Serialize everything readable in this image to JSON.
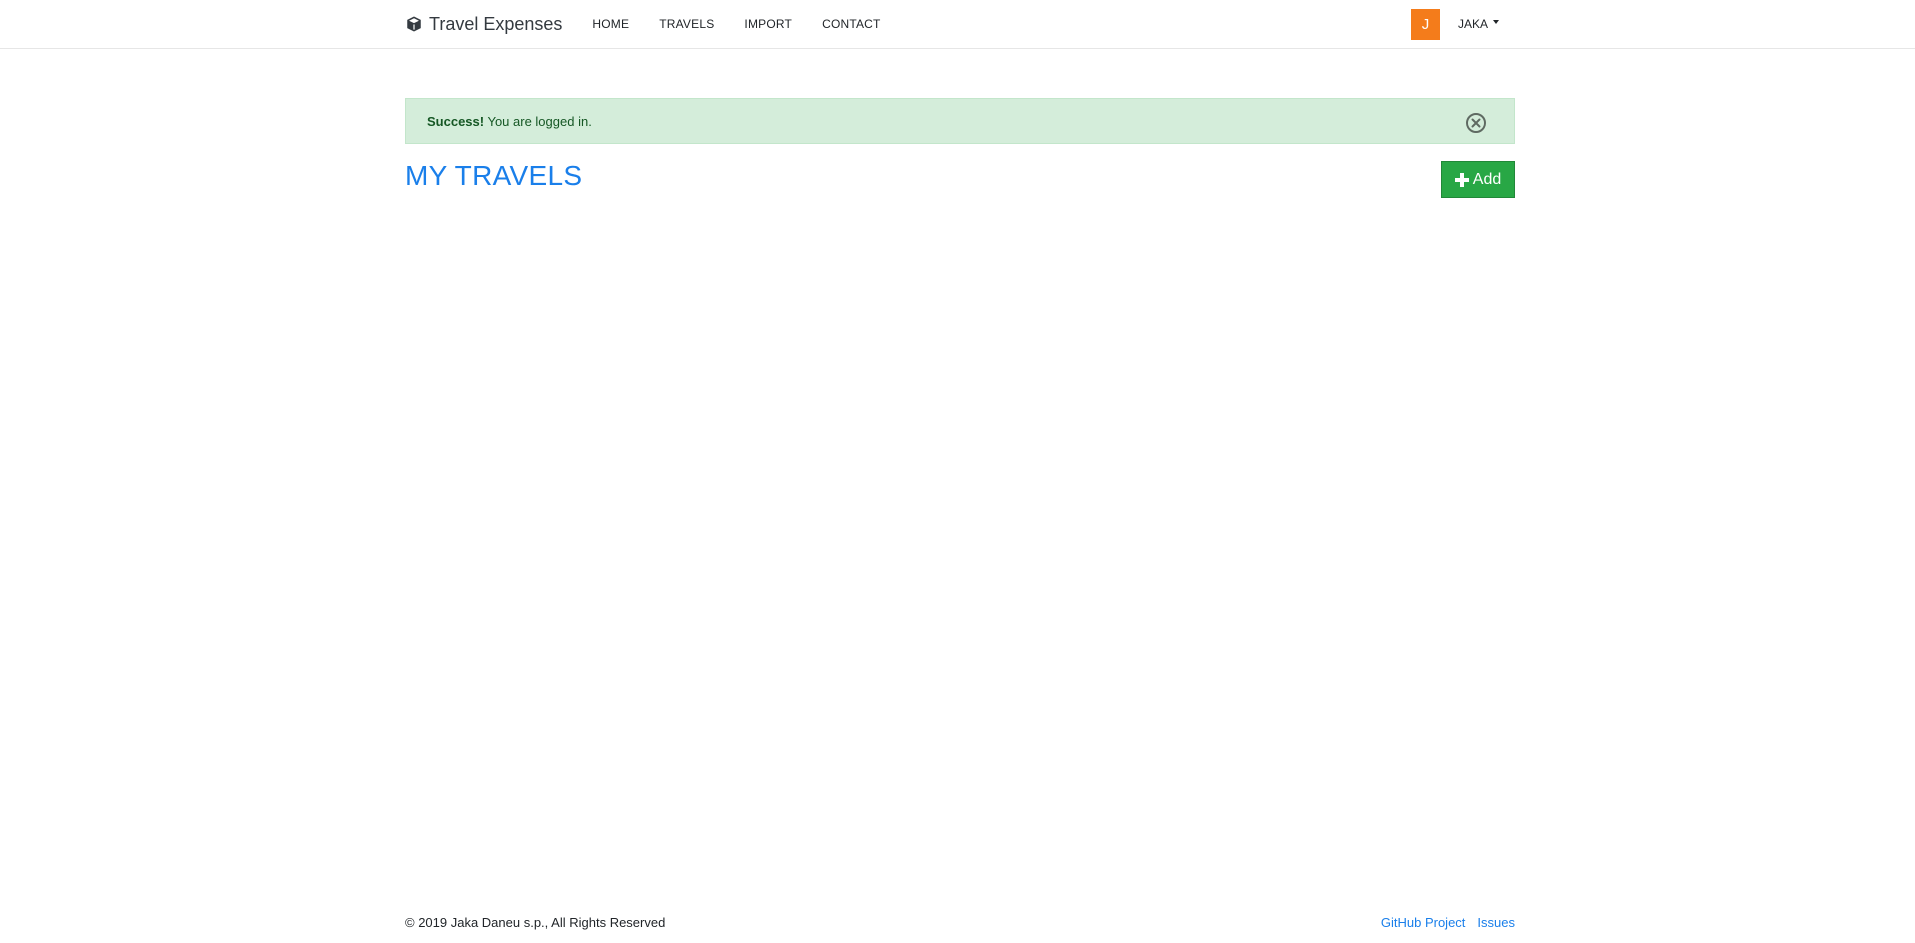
{
  "nav": {
    "brand": "Travel Expenses",
    "links": [
      {
        "label": "HOME"
      },
      {
        "label": "TRAVELS"
      },
      {
        "label": "IMPORT"
      },
      {
        "label": "CONTACT"
      }
    ],
    "user": {
      "initial": "J",
      "name": "JAKA",
      "avatar_color": "#f47c1b"
    }
  },
  "alert": {
    "strong": "Success!",
    "message": " You are logged in.",
    "close_icon": "close-circle-icon",
    "bg_color": "#d4edda"
  },
  "main": {
    "title": "MY TRAVELS",
    "add_label": "Add",
    "add_icon": "plus-icon",
    "add_color": "#28a745"
  },
  "footer": {
    "copyright": "© 2019 Jaka Daneu s.p., All Rights Reserved",
    "links": [
      {
        "label": "GitHub Project"
      },
      {
        "label": "Issues"
      }
    ]
  },
  "colors": {
    "accent": "#1a7fea"
  }
}
